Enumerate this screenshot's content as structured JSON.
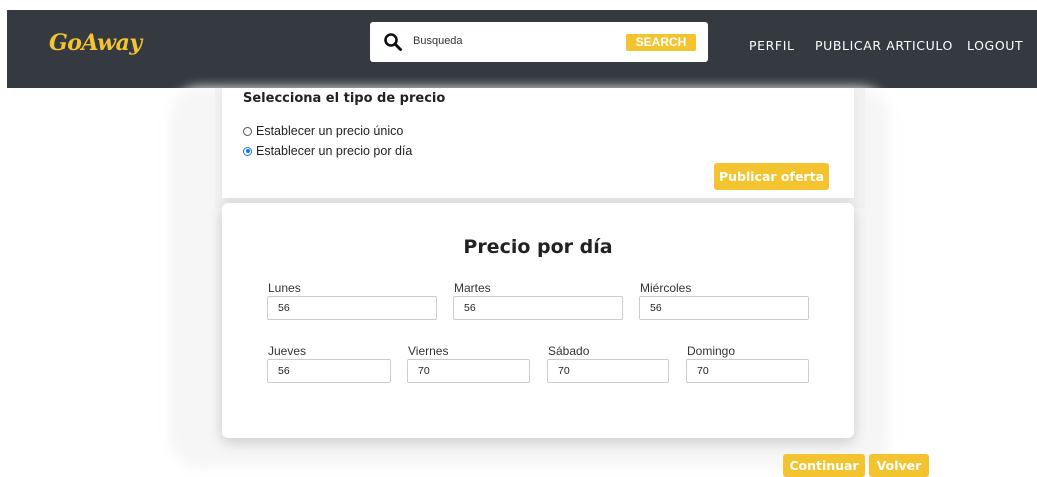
{
  "navbar": {
    "logo": "GoAway",
    "search": {
      "placeholder": "Busqueda",
      "button_label": "SEARCH",
      "icon": "search-icon"
    },
    "links": [
      "PERFIL",
      "PUBLICAR ARTICULO",
      "LOGOUT"
    ]
  },
  "price_type": {
    "title": "Selecciona el tipo de precio",
    "options": [
      {
        "label": "Establecer un precio único",
        "checked": false
      },
      {
        "label": "Establecer un precio por día",
        "checked": true
      }
    ],
    "publish_button": "Publicar oferta"
  },
  "daily_price": {
    "title": "Precio por día",
    "days": [
      {
        "label": "Lunes",
        "value": "56"
      },
      {
        "label": "Martes",
        "value": "56"
      },
      {
        "label": "Miércoles",
        "value": "56"
      },
      {
        "label": "Jueves",
        "value": "56"
      },
      {
        "label": "Viernes",
        "value": "70"
      },
      {
        "label": "Sábado",
        "value": "70"
      },
      {
        "label": "Domingo",
        "value": "70"
      }
    ]
  },
  "actions": {
    "continue_label": "Continuar",
    "back_label": "Volver"
  },
  "colors": {
    "navbar": "#353a40",
    "accent": "#f4c430"
  }
}
